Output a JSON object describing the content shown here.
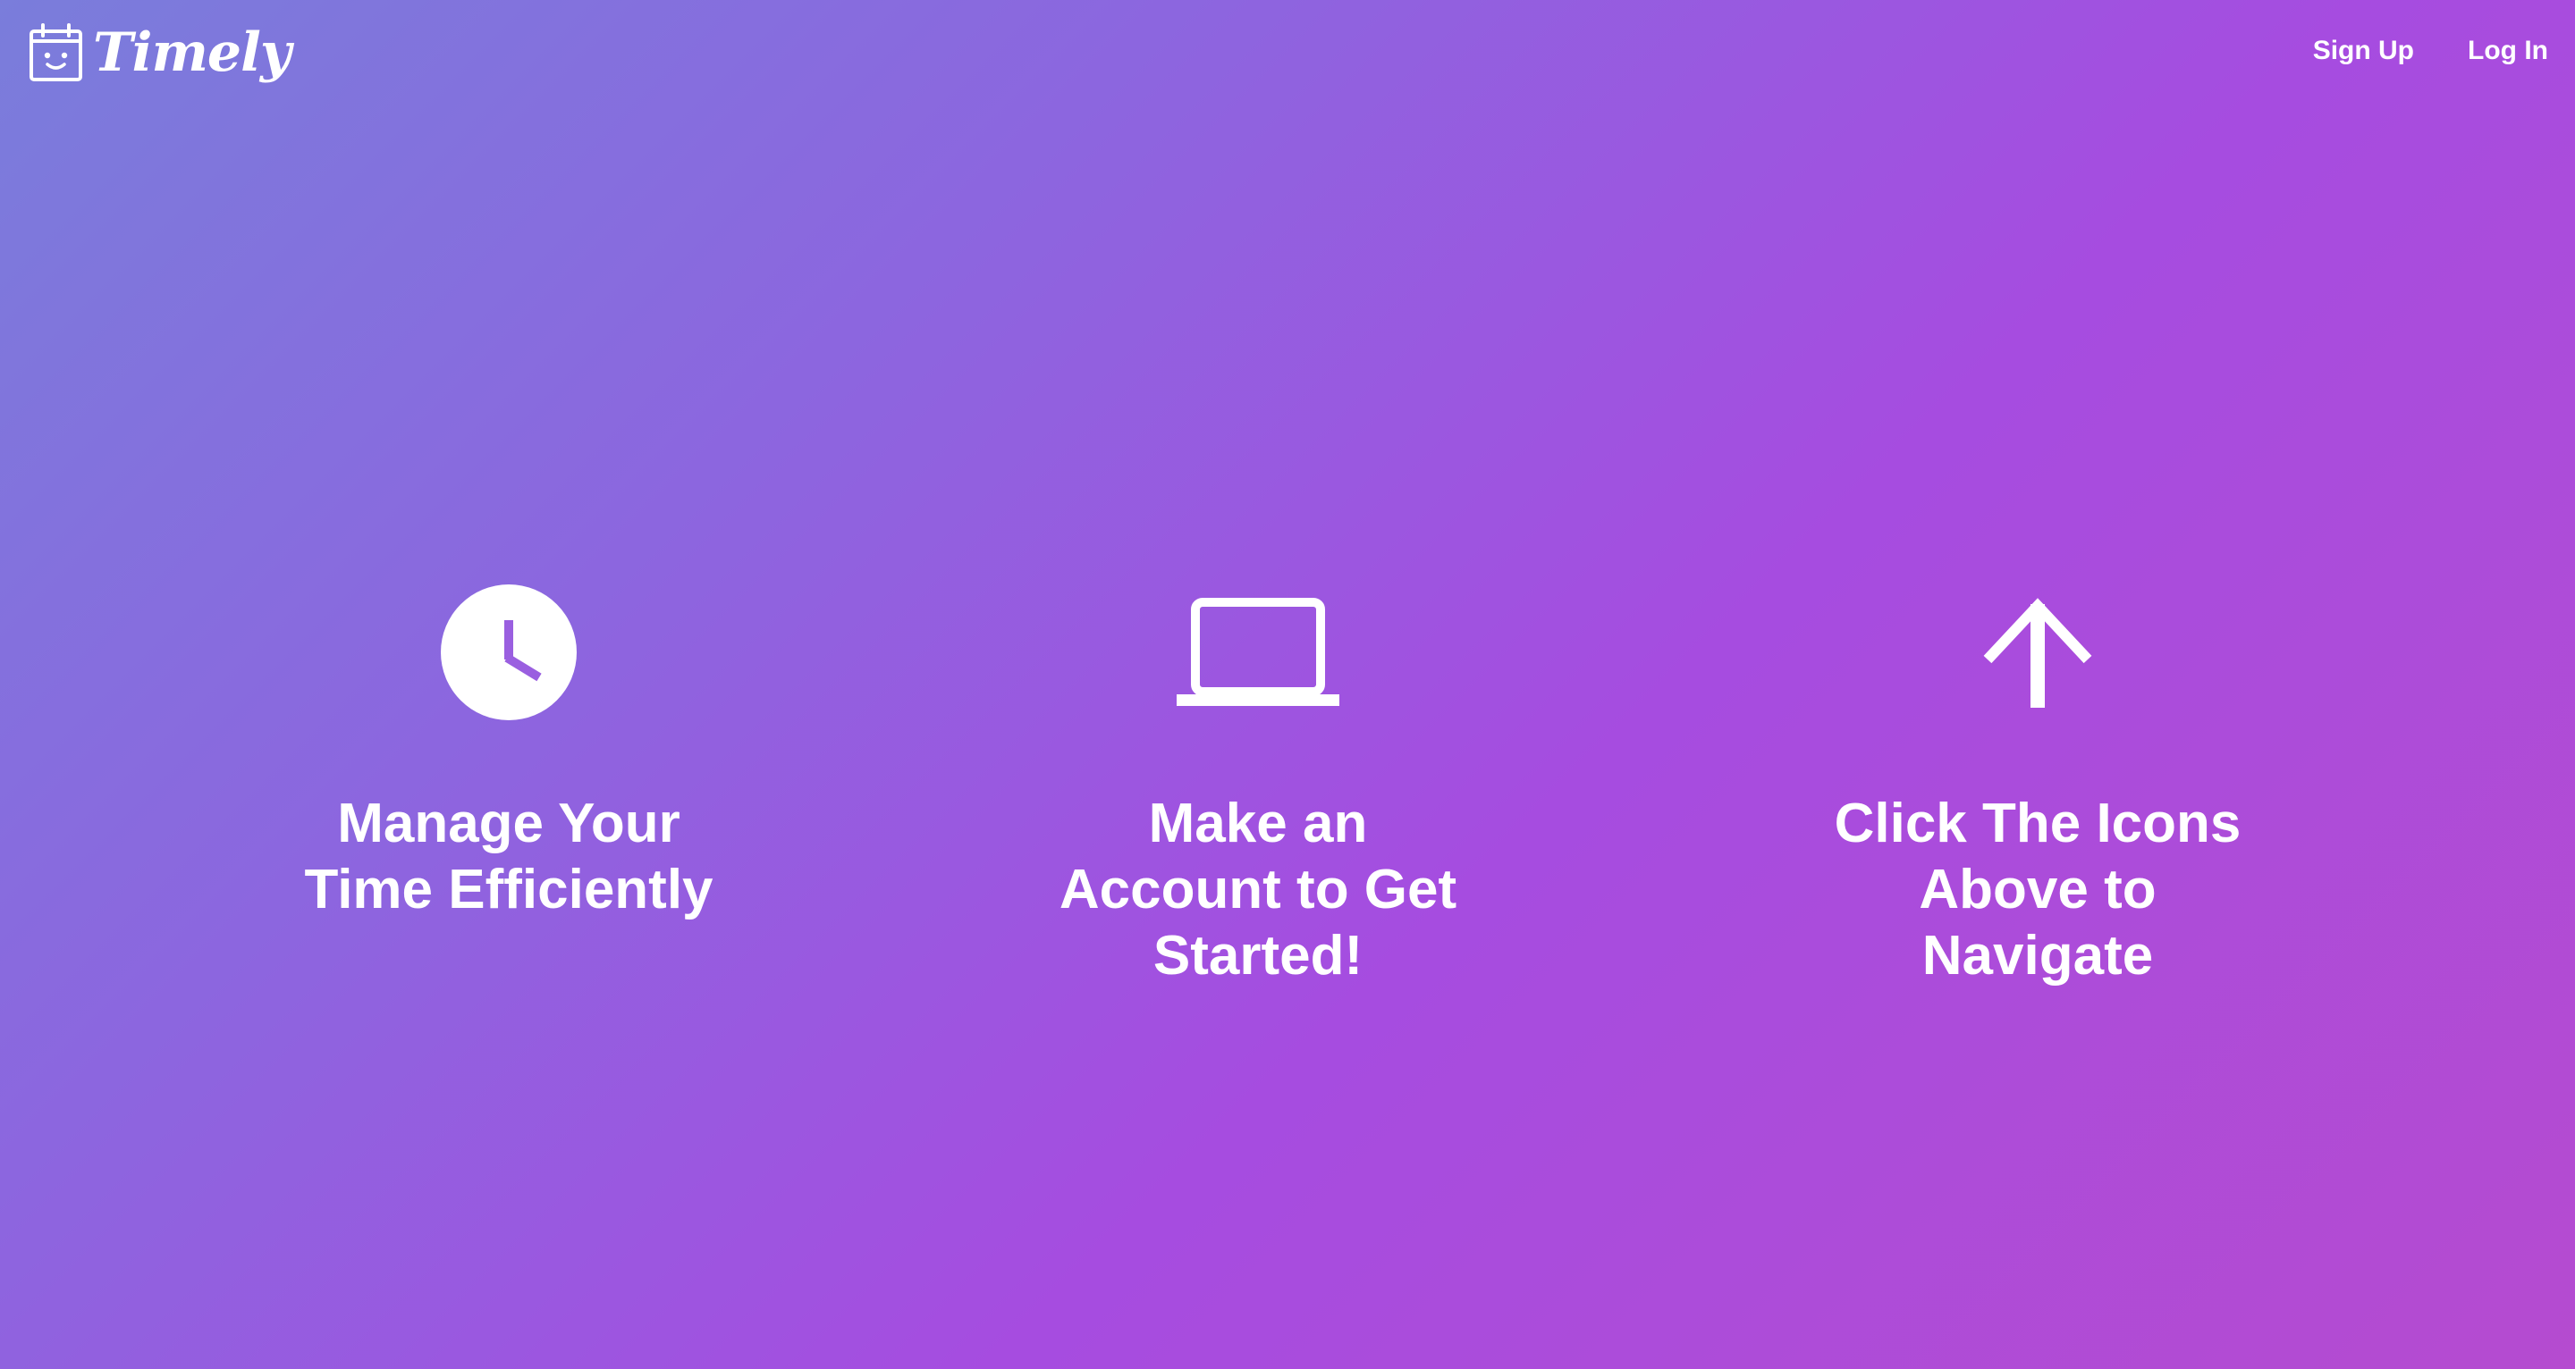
{
  "brand": {
    "name": "Timely",
    "icon": "calendar-smiley-icon"
  },
  "nav": {
    "sign_up": "Sign Up",
    "log_in": "Log In"
  },
  "features": [
    {
      "icon": "clock-icon",
      "caption": "Manage Your Time Efficiently"
    },
    {
      "icon": "laptop-icon",
      "caption": "Make an Account to Get Started!"
    },
    {
      "icon": "arrow-up-icon",
      "caption": "Click The Icons Above to Navigate"
    }
  ],
  "colors": {
    "gradient_start": "#7a7ddb",
    "gradient_mid": "#a64ce0",
    "gradient_end": "#b54bd0",
    "text": "#ffffff"
  }
}
